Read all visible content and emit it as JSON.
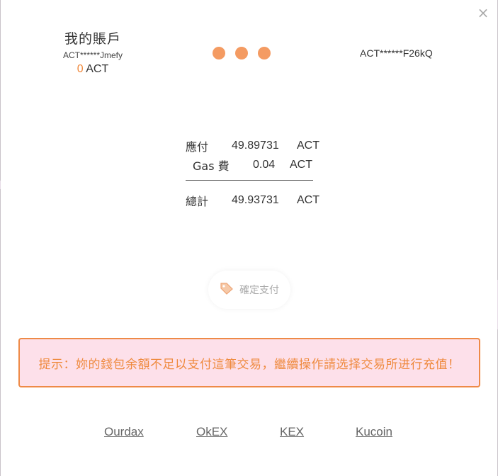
{
  "close_icon": "×",
  "sender": {
    "title": "我的賬戶",
    "address": "ACT******Jmefy",
    "balance_value": "0",
    "balance_unit": "ACT"
  },
  "receiver": {
    "address": "ACT******F26kQ"
  },
  "bill": {
    "payable_label": "應付",
    "payable_amount": "49.89731",
    "payable_unit": "ACT",
    "gas_label": "Gas 費",
    "gas_amount": "0.04",
    "gas_unit": "ACT",
    "total_label": "總計",
    "total_amount": "49.93731",
    "total_unit": "ACT"
  },
  "confirm_button": {
    "label": "確定支付",
    "icon": "tag-icon"
  },
  "notice": {
    "text": "提示：妳的錢包余額不足以支付這筆交易，繼續操作請选择交易所进行充值！"
  },
  "exchanges": [
    "Ourdax",
    "OkEX",
    "KEX",
    "Kucoin"
  ],
  "colors": {
    "accent": "#f0883b",
    "dot": "#f49b62",
    "notice_border": "#ee8a47",
    "notice_bg": "#fde0ea"
  }
}
